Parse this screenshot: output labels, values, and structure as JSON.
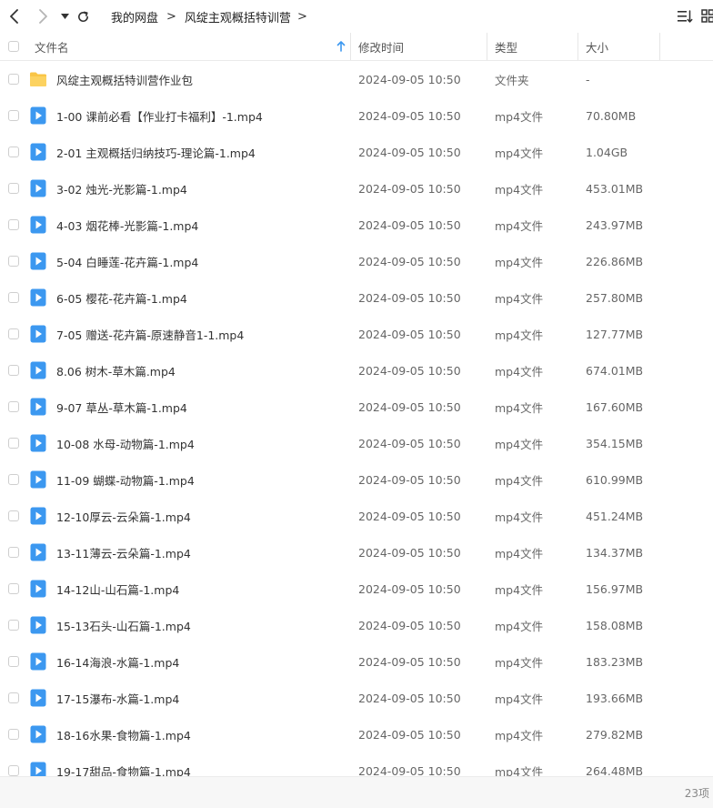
{
  "toolbar": {
    "back_icon": "chevron-left-icon",
    "forward_icon": "chevron-right-icon",
    "history_icon": "caret-down-icon",
    "refresh_icon": "refresh-icon",
    "sort_icon": "sort-list-icon",
    "view_icon": "grid-view-icon"
  },
  "breadcrumb": {
    "root": "我的网盘",
    "separator": ">",
    "current": "风绽主观概括特训营"
  },
  "columns": {
    "name": "文件名",
    "modified": "修改时间",
    "type": "类型",
    "size": "大小"
  },
  "colors": {
    "folder": "#F9C546",
    "video": "#3C98F0",
    "sort_arrow": "#3C98F0"
  },
  "files": [
    {
      "name": "风绽主观概括特训营作业包",
      "modified": "2024-09-05 10:50",
      "type": "文件夹",
      "size": "-",
      "icon": "folder-icon"
    },
    {
      "name": "1-00 课前必看【作业打卡福利】-1.mp4",
      "modified": "2024-09-05 10:50",
      "type": "mp4文件",
      "size": "70.80MB",
      "icon": "video-file-icon"
    },
    {
      "name": "2-01 主观概括归纳技巧-理论篇-1.mp4",
      "modified": "2024-09-05 10:50",
      "type": "mp4文件",
      "size": "1.04GB",
      "icon": "video-file-icon"
    },
    {
      "name": "3-02 烛光-光影篇-1.mp4",
      "modified": "2024-09-05 10:50",
      "type": "mp4文件",
      "size": "453.01MB",
      "icon": "video-file-icon"
    },
    {
      "name": "4-03 烟花棒-光影篇-1.mp4",
      "modified": "2024-09-05 10:50",
      "type": "mp4文件",
      "size": "243.97MB",
      "icon": "video-file-icon"
    },
    {
      "name": "5-04 白睡莲-花卉篇-1.mp4",
      "modified": "2024-09-05 10:50",
      "type": "mp4文件",
      "size": "226.86MB",
      "icon": "video-file-icon"
    },
    {
      "name": "6-05 樱花-花卉篇-1.mp4",
      "modified": "2024-09-05 10:50",
      "type": "mp4文件",
      "size": "257.80MB",
      "icon": "video-file-icon"
    },
    {
      "name": "7-05 赠送-花卉篇-原速静音1-1.mp4",
      "modified": "2024-09-05 10:50",
      "type": "mp4文件",
      "size": "127.77MB",
      "icon": "video-file-icon"
    },
    {
      "name": "8.06 树木-草木篇.mp4",
      "modified": "2024-09-05 10:50",
      "type": "mp4文件",
      "size": "674.01MB",
      "icon": "video-file-icon"
    },
    {
      "name": "9-07 草丛-草木篇-1.mp4",
      "modified": "2024-09-05 10:50",
      "type": "mp4文件",
      "size": "167.60MB",
      "icon": "video-file-icon"
    },
    {
      "name": "10-08 水母-动物篇-1.mp4",
      "modified": "2024-09-05 10:50",
      "type": "mp4文件",
      "size": "354.15MB",
      "icon": "video-file-icon"
    },
    {
      "name": "11-09 蝴蝶-动物篇-1.mp4",
      "modified": "2024-09-05 10:50",
      "type": "mp4文件",
      "size": "610.99MB",
      "icon": "video-file-icon"
    },
    {
      "name": "12-10厚云-云朵篇-1.mp4",
      "modified": "2024-09-05 10:50",
      "type": "mp4文件",
      "size": "451.24MB",
      "icon": "video-file-icon"
    },
    {
      "name": "13-11薄云-云朵篇-1.mp4",
      "modified": "2024-09-05 10:50",
      "type": "mp4文件",
      "size": "134.37MB",
      "icon": "video-file-icon"
    },
    {
      "name": "14-12山-山石篇-1.mp4",
      "modified": "2024-09-05 10:50",
      "type": "mp4文件",
      "size": "156.97MB",
      "icon": "video-file-icon"
    },
    {
      "name": "15-13石头-山石篇-1.mp4",
      "modified": "2024-09-05 10:50",
      "type": "mp4文件",
      "size": "158.08MB",
      "icon": "video-file-icon"
    },
    {
      "name": "16-14海浪-水篇-1.mp4",
      "modified": "2024-09-05 10:50",
      "type": "mp4文件",
      "size": "183.23MB",
      "icon": "video-file-icon"
    },
    {
      "name": "17-15瀑布-水篇-1.mp4",
      "modified": "2024-09-05 10:50",
      "type": "mp4文件",
      "size": "193.66MB",
      "icon": "video-file-icon"
    },
    {
      "name": "18-16水果-食物篇-1.mp4",
      "modified": "2024-09-05 10:50",
      "type": "mp4文件",
      "size": "279.82MB",
      "icon": "video-file-icon"
    },
    {
      "name": "19-17甜品-食物篇-1.mp4",
      "modified": "2024-09-05 10:50",
      "type": "mp4文件",
      "size": "264.48MB",
      "icon": "video-file-icon"
    }
  ],
  "footer": {
    "item_count": "23项"
  }
}
